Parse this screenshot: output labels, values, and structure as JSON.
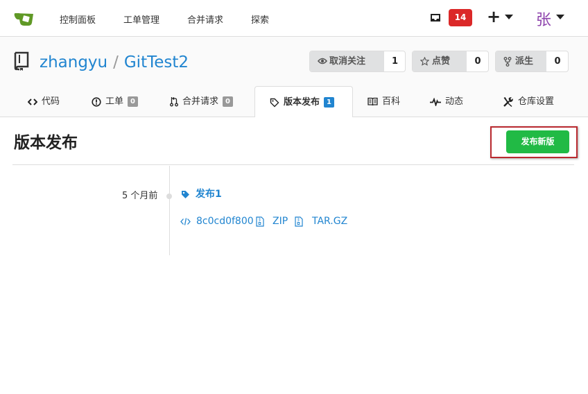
{
  "navbar": {
    "links": [
      "控制面板",
      "工单管理",
      "合并请求",
      "探索"
    ],
    "notification_count": "14",
    "plus": "+",
    "avatar_char": "张"
  },
  "repo": {
    "owner": "zhangyu",
    "separator": "/",
    "name": "GitTest2",
    "watch": {
      "label": "取消关注",
      "count": "1"
    },
    "star": {
      "label": "点赞",
      "count": "0"
    },
    "fork": {
      "label": "派生",
      "count": "0"
    }
  },
  "tabs": [
    {
      "label": "代码",
      "icon": "code-icon"
    },
    {
      "label": "工单",
      "icon": "issue-icon",
      "count": "0"
    },
    {
      "label": "合并请求",
      "icon": "pull-request-icon",
      "count": "0"
    },
    {
      "label": "版本发布",
      "icon": "tag-icon",
      "count": "1",
      "active": true
    },
    {
      "label": "百科",
      "icon": "book-icon"
    },
    {
      "label": "动态",
      "icon": "pulse-icon"
    },
    {
      "label": "仓库设置",
      "icon": "tools-icon"
    }
  ],
  "page": {
    "heading": "版本发布",
    "new_release_button": "发布新版"
  },
  "releases": [
    {
      "time_ago": "5 个月前",
      "title": "发布1",
      "commit": "8c0cd0f800",
      "zip_label": "ZIP",
      "targz_label": "TAR.GZ"
    }
  ],
  "colors": {
    "accent": "#2185d0",
    "badge_red": "#db2828",
    "primary_green": "#21ba45",
    "highlight_border": "#b9292f",
    "avatar": "#8e44ad"
  }
}
